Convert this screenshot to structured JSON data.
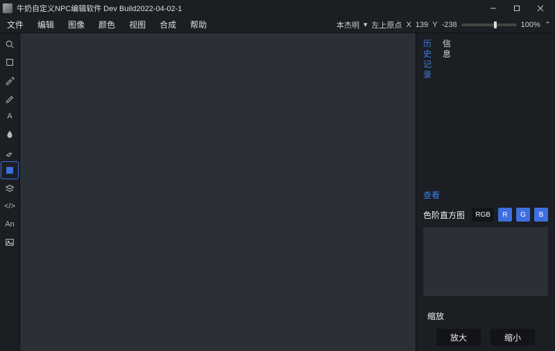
{
  "title": "牛奶自定义NPC编辑软件 Dev Build2022-04-02-1",
  "menus": [
    "文件",
    "编辑",
    "图像",
    "颜色",
    "视图",
    "合成",
    "帮助"
  ],
  "coord": {
    "user": "本杰明",
    "origin": "左上原点",
    "x_label": "X",
    "x_val": "139",
    "y_label": "Y",
    "y_val": "-238",
    "zoom": "100%"
  },
  "slider_pos_pct": 62,
  "tools": [
    {
      "name": "search-icon"
    },
    {
      "name": "rect-select-icon"
    },
    {
      "name": "eyedropper-icon"
    },
    {
      "name": "pencil-icon"
    },
    {
      "name": "text-icon",
      "label": "A"
    },
    {
      "name": "drop-icon"
    },
    {
      "name": "brush-icon"
    },
    {
      "name": "shape-icon",
      "selected": true,
      "blue": true
    },
    {
      "name": "layers-icon"
    },
    {
      "name": "code-icon",
      "label": "</>"
    },
    {
      "name": "anim-icon",
      "label": "An"
    },
    {
      "name": "image-icon"
    }
  ],
  "right": {
    "tabs": [
      {
        "label": "历史记录",
        "active": true
      },
      {
        "label": "信息",
        "active": false
      }
    ],
    "view": "查看",
    "histogram": "色阶直方图",
    "chips": {
      "rgb": "RGB",
      "r": "R",
      "g": "G",
      "b": "B"
    },
    "zoom": "缩放",
    "zoom_in": "放大",
    "zoom_out": "缩小"
  }
}
